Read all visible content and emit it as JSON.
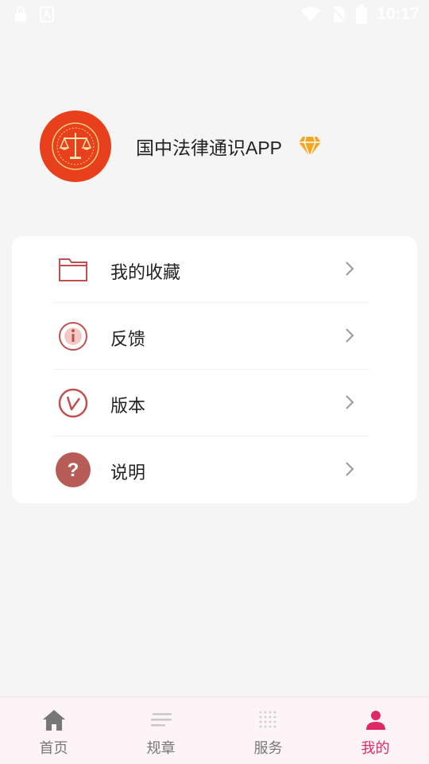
{
  "status_bar": {
    "time": "10:17",
    "left_icons": [
      "lock-icon",
      "font-a-icon"
    ],
    "right_icons": [
      "wifi-icon",
      "no-sim-icon",
      "battery-icon"
    ]
  },
  "profile": {
    "app_name": "国中法律通识APP",
    "avatar_icon": "scales-of-justice-icon",
    "badge_icon": "diamond-icon",
    "avatar_color": "#e8401c",
    "badge_color": "#f5a623"
  },
  "menu": {
    "items": [
      {
        "label": "我的收藏",
        "icon": "folder-icon"
      },
      {
        "label": "反馈",
        "icon": "info-icon"
      },
      {
        "label": "版本",
        "icon": "check-circle-icon"
      },
      {
        "label": "说明",
        "icon": "question-icon"
      }
    ],
    "icon_color": "#c0504f"
  },
  "tabbar": {
    "items": [
      {
        "label": "首页",
        "icon": "home-icon",
        "active": false
      },
      {
        "label": "规章",
        "icon": "list-icon",
        "active": false
      },
      {
        "label": "服务",
        "icon": "dots-grid-icon",
        "active": false
      },
      {
        "label": "我的",
        "icon": "person-icon",
        "active": true
      }
    ],
    "active_color": "#e02864",
    "inactive_color": "#777777"
  }
}
